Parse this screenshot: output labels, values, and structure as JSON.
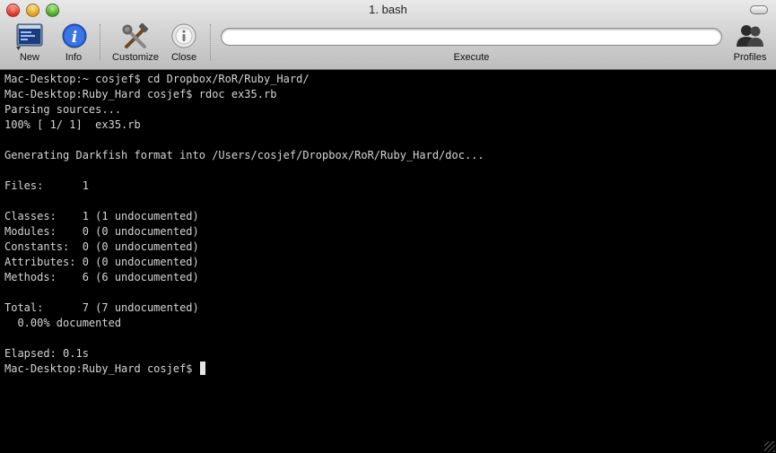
{
  "window": {
    "title": "1. bash"
  },
  "toolbar": {
    "new_label": "New",
    "info_label": "Info",
    "customize_label": "Customize",
    "close_label": "Close",
    "execute_label": "Execute",
    "execute_value": "",
    "profiles_label": "Profiles",
    "icons": {
      "new": "new-terminal-icon",
      "info": "info-icon",
      "customize": "tools-icon",
      "close": "close-icon",
      "profiles": "profiles-icon"
    }
  },
  "terminal": {
    "lines": [
      "Mac-Desktop:~ cosjef$ cd Dropbox/RoR/Ruby_Hard/",
      "Mac-Desktop:Ruby_Hard cosjef$ rdoc ex35.rb",
      "Parsing sources...",
      "100% [ 1/ 1]  ex35.rb",
      "",
      "Generating Darkfish format into /Users/cosjef/Dropbox/RoR/Ruby_Hard/doc...",
      "",
      "Files:      1",
      "",
      "Classes:    1 (1 undocumented)",
      "Modules:    0 (0 undocumented)",
      "Constants:  0 (0 undocumented)",
      "Attributes: 0 (0 undocumented)",
      "Methods:    6 (6 undocumented)",
      "",
      "Total:      7 (7 undocumented)",
      "  0.00% documented",
      "",
      "Elapsed: 0.1s"
    ],
    "prompt": "Mac-Desktop:Ruby_Hard cosjef$ "
  },
  "colors": {
    "terminal_bg": "#000000",
    "terminal_fg": "#d4d4d4",
    "info_blue": "#2a5fd0"
  }
}
